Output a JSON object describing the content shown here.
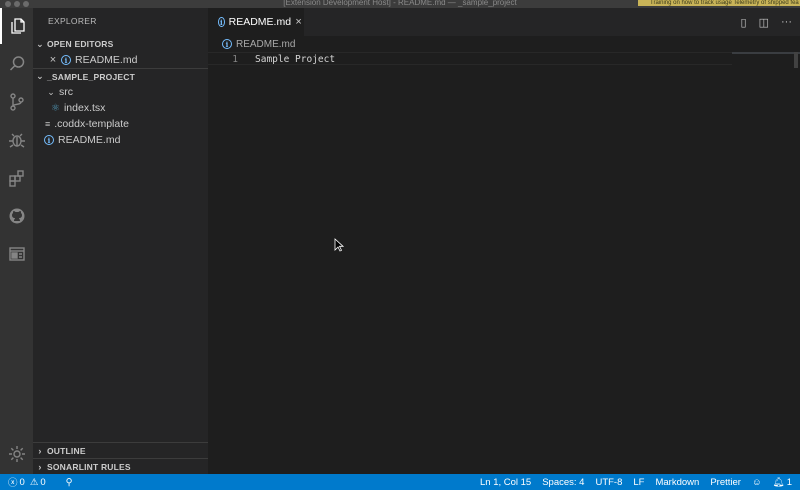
{
  "window": {
    "title": "[Extension Development Host] - README.md — _sample_project",
    "notice": "Training on how to track usage Telemetry of shipped fea"
  },
  "activity_bar": {
    "items": [
      {
        "name": "explorer",
        "icon": "files-icon",
        "active": true
      },
      {
        "name": "search",
        "icon": "search-icon"
      },
      {
        "name": "source-control",
        "icon": "source-control-icon"
      },
      {
        "name": "debug",
        "icon": "debug-icon"
      },
      {
        "name": "extensions",
        "icon": "extensions-icon"
      },
      {
        "name": "github",
        "icon": "github-icon"
      },
      {
        "name": "panel",
        "icon": "panel-icon"
      }
    ],
    "bottom": {
      "name": "manage",
      "icon": "gear-icon"
    }
  },
  "sidebar": {
    "title": "EXPLORER",
    "open_editors": {
      "header": "OPEN EDITORS",
      "items": [
        {
          "label": "README.md",
          "icon": "info-icon"
        }
      ]
    },
    "project": {
      "header": "_SAMPLE_PROJECT",
      "folder": "src",
      "files": {
        "index": "index.tsx",
        "template": ".coddx-template",
        "readme": "README.md"
      }
    },
    "outline": "OUTLINE",
    "sonarlint": "SONARLINT RULES"
  },
  "tabs": [
    {
      "label": "README.md",
      "icon": "info-icon",
      "active": true
    }
  ],
  "breadcrumb": {
    "label": "README.md"
  },
  "editor": {
    "lines": [
      {
        "number": "1",
        "text": "Sample Project"
      }
    ]
  },
  "status_bar": {
    "errors": "0",
    "warnings": "0",
    "position": "Ln 1, Col 15",
    "spaces": "Spaces: 4",
    "encoding": "UTF-8",
    "eol": "LF",
    "language": "Markdown",
    "formatter": "Prettier",
    "notifications": "1"
  },
  "colors": {
    "status_bar": "#007acc",
    "accent_info": "#75beff",
    "notice_bg": "#c9b458"
  }
}
